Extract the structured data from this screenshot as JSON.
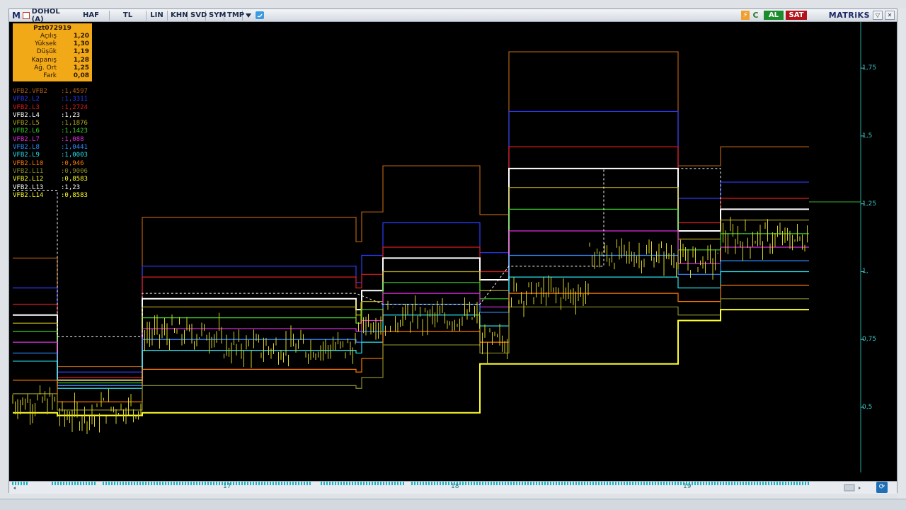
{
  "toolbar": {
    "symbol": "DOHOL (A)",
    "buttons": [
      "HAF",
      "TL",
      "LIN",
      "KHN",
      "SVD",
      "SYM",
      "TMP"
    ],
    "al_label": "AL",
    "sat_label": "SAT",
    "brand": "MATRiKS"
  },
  "infobox": {
    "date": "Pzt072919",
    "rows": [
      {
        "label": "Açılış",
        "value": "1,20"
      },
      {
        "label": "Yüksek",
        "value": "1,30"
      },
      {
        "label": "Düşük",
        "value": "1,19"
      },
      {
        "label": "Kapanış",
        "value": "1,28"
      },
      {
        "label": "Ağ. Ort",
        "value": "1,25"
      },
      {
        "label": "Fark",
        "value": "0,08"
      }
    ]
  },
  "legend": [
    {
      "name": "VFB2.VFB2",
      "value": ":1,4597",
      "color": "#b45f0f"
    },
    {
      "name": "VFB2.L2",
      "value": ":1,3311",
      "color": "#2b3cff"
    },
    {
      "name": "VFB2.L3",
      "value": ":1,2724",
      "color": "#e01b1b"
    },
    {
      "name": "VFB2.L4",
      "value": ":1,23",
      "color": "#ffffff"
    },
    {
      "name": "VFB2.L5",
      "value": ":1,1876",
      "color": "#b6a81a"
    },
    {
      "name": "VFB2.L6",
      "value": ":1,1423",
      "color": "#3ccf2b"
    },
    {
      "name": "VFB2.L7",
      "value": ":1,088",
      "color": "#e02ce0"
    },
    {
      "name": "VFB2.L8",
      "value": ":1,0441",
      "color": "#2f8cff"
    },
    {
      "name": "VFB2.L9",
      "value": ":1,0003",
      "color": "#27e2ef"
    },
    {
      "name": "VFB2.L10",
      "value": ":0,946",
      "color": "#ff7a00"
    },
    {
      "name": "VFB2.L11",
      "value": ":0,9006",
      "color": "#8a8a2a"
    },
    {
      "name": "VFB2.L12",
      "value": ":0,8583",
      "color": "#ffff2a"
    },
    {
      "name": "VFB2.L13",
      "value": ":1,23",
      "color": "#ffffff"
    },
    {
      "name": "VFB2.L14",
      "value": ":0,8583",
      "color": "#ffff2a"
    }
  ],
  "y_axis": {
    "ticks": [
      "1,75",
      "1,5",
      "1,25",
      "1,",
      "0,75",
      "0,5"
    ],
    "tick_values": [
      1.75,
      1.5,
      1.25,
      1.0,
      0.75,
      0.5
    ],
    "range": [
      0.26,
      1.92
    ],
    "color": "#3cc6c6"
  },
  "x_axis": {
    "date_labels": [
      "17",
      "18",
      "19"
    ]
  },
  "chart_data": {
    "type": "line",
    "series_names": [
      "VFB2.VFB2",
      "VFB2.L2",
      "VFB2.L3",
      "VFB2.L4",
      "VFB2.L5",
      "VFB2.L6",
      "VFB2.L7",
      "VFB2.L8",
      "VFB2.L9",
      "VFB2.L10",
      "VFB2.L11",
      "VFB2.L12",
      "VFB2.L13",
      "VFB2.L14"
    ],
    "last_values": [
      1.4597,
      1.3311,
      1.2724,
      1.23,
      1.1876,
      1.1423,
      1.088,
      1.0441,
      1.0003,
      0.946,
      0.9006,
      0.8583,
      1.23,
      0.8583
    ],
    "ohlc_last": {
      "open": 1.2,
      "high": 1.3,
      "low": 1.19,
      "close": 1.28,
      "avg": 1.25,
      "change": 0.08
    }
  },
  "colors": {
    "background": "#000000",
    "price_bars": "#d9d21f",
    "accent": "#f2a918"
  }
}
